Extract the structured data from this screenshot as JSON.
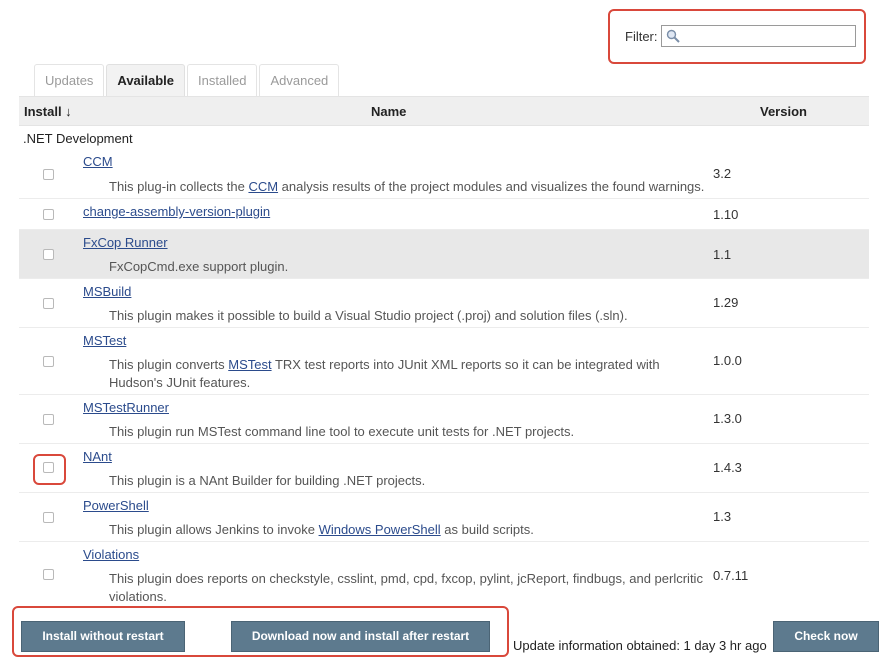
{
  "filter": {
    "label": "Filter:",
    "value": ""
  },
  "tabs": [
    "Updates",
    "Available",
    "Installed",
    "Advanced"
  ],
  "active_tab": "Available",
  "table": {
    "headers": {
      "install": "Install ↓",
      "name": "Name",
      "version": "Version"
    },
    "category": ".NET Development",
    "rows": [
      {
        "name": "CCM",
        "desc_before": "This plug-in collects the ",
        "desc_link": "CCM",
        "desc_after": " analysis results of the project modules and visualizes the found warnings.",
        "version": "3.2"
      },
      {
        "name": "change-assembly-version-plugin",
        "desc_before": "",
        "desc_link": "",
        "desc_after": "",
        "version": "1.10"
      },
      {
        "name": "FxCop Runner",
        "desc_before": "FxCopCmd.exe support plugin.",
        "desc_link": "",
        "desc_after": "",
        "version": "1.1"
      },
      {
        "name": "MSBuild",
        "desc_before": "This plugin makes it possible to build a Visual Studio project (.proj) and solution files (.sln).",
        "desc_link": "",
        "desc_after": "",
        "version": "1.29"
      },
      {
        "name": "MSTest",
        "desc_before": "This plugin converts ",
        "desc_link": "MSTest",
        "desc_after": " TRX test reports into JUnit XML reports so it can be integrated with Hudson's JUnit features.",
        "version": "1.0.0"
      },
      {
        "name": "MSTestRunner",
        "desc_before": "This plugin run MSTest command line tool to execute unit tests for .NET projects.",
        "desc_link": "",
        "desc_after": "",
        "version": "1.3.0"
      },
      {
        "name": "NAnt",
        "desc_before": "This plugin is a NAnt Builder for building .NET projects.",
        "desc_link": "",
        "desc_after": "",
        "version": "1.4.3"
      },
      {
        "name": "PowerShell",
        "desc_before": "This plugin allows Jenkins to invoke ",
        "desc_link": "Windows PowerShell",
        "desc_after": " as build scripts.",
        "version": "1.3"
      },
      {
        "name": "Violations",
        "desc_before": "This plugin does reports on checkstyle, csslint, pmd, cpd, fxcop, pylint, jcReport, findbugs, and perlcritic violations.",
        "desc_link": "",
        "desc_after": "",
        "version": "0.7.11"
      }
    ]
  },
  "buttons": {
    "install": "Install without restart",
    "download": "Download now and install after restart",
    "check": "Check now"
  },
  "update_info": "Update information obtained: 1 day 3 hr ago",
  "colors": {
    "annotation": "#d9483b",
    "button": "#5d7a8e",
    "link": "#2b4b8c"
  },
  "icons": {
    "filter": "search-icon"
  }
}
